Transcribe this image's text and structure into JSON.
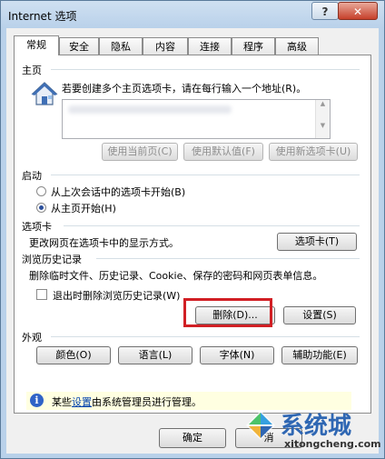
{
  "window": {
    "title": "Internet 选项",
    "help_label": "?",
    "close_label": "✕"
  },
  "tabs": [
    {
      "label": "常规",
      "active": true
    },
    {
      "label": "安全"
    },
    {
      "label": "隐私"
    },
    {
      "label": "内容"
    },
    {
      "label": "连接"
    },
    {
      "label": "程序"
    },
    {
      "label": "高级"
    }
  ],
  "homepage": {
    "heading": "主页",
    "hint": "若要创建多个主页选项卡，请在每行输入一个地址(R)。",
    "icon": "house-icon",
    "buttons": {
      "use_current": "使用当前页(C)",
      "use_default": "使用默认值(F)",
      "use_new_tab": "使用新选项卡(U)"
    }
  },
  "startup": {
    "heading": "启动",
    "option_last_session": "从上次会话中的选项卡开始(B)",
    "option_homepage": "从主页开始(H)",
    "selected": "option_homepage"
  },
  "tabs_section": {
    "heading": "选项卡",
    "desc": "更改网页在选项卡中的显示方式。",
    "button": "选项卡(T)"
  },
  "history": {
    "heading": "浏览历史记录",
    "desc": "删除临时文件、历史记录、Cookie、保存的密码和网页表单信息。",
    "exit_checkbox": "退出时删除浏览历史记录(W)",
    "delete_button": "删除(D)...",
    "settings_button": "设置(S)"
  },
  "appearance": {
    "heading": "外观",
    "colors_button": "颜色(O)",
    "languages_button": "语言(L)",
    "fonts_button": "字体(N)",
    "accessibility_button": "辅助功能(E)"
  },
  "info": {
    "prefix": "某些",
    "link": "设置",
    "suffix": "由系统管理员进行管理。"
  },
  "footer": {
    "ok_button": "确定",
    "cancel_button": "消"
  },
  "watermark": {
    "cn": "系统城",
    "en": "xitongcheng.com"
  },
  "colors": {
    "highlight": "#d11f24",
    "info_bg": "#ffffe1",
    "link": "#0645ad"
  }
}
